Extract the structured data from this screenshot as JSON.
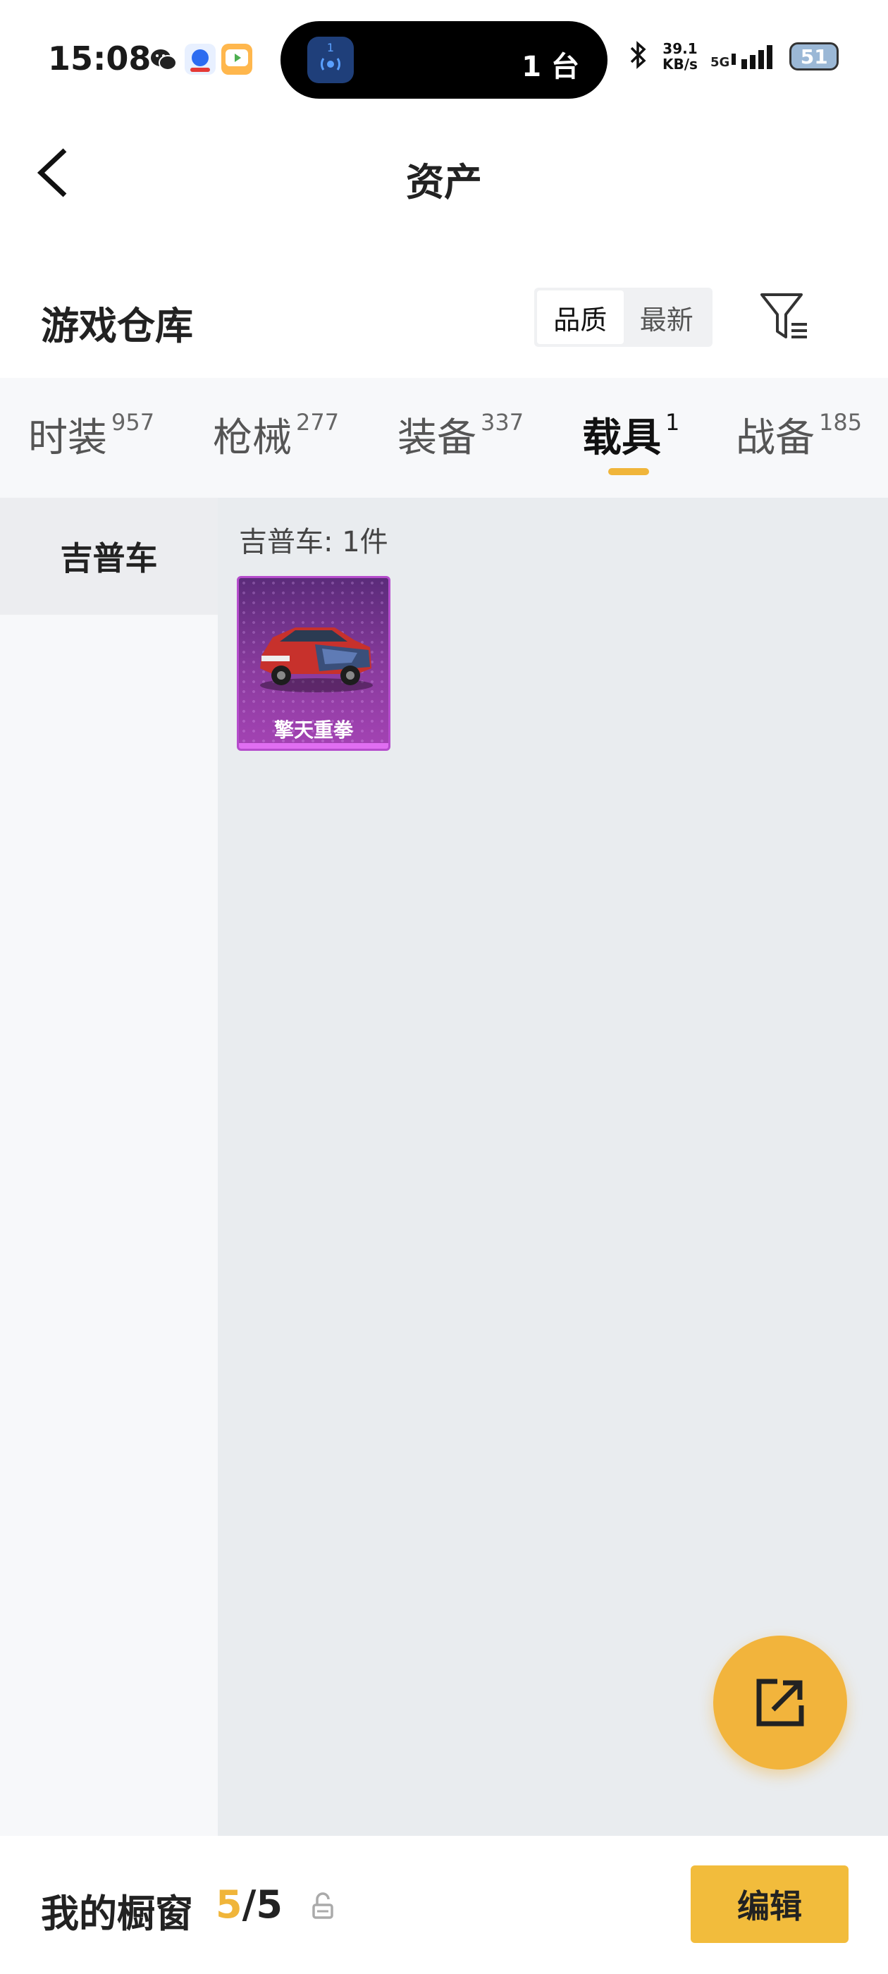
{
  "status": {
    "time": "15:08",
    "island_badge": "1",
    "island_text": "1 台",
    "net_speed_value": "39.1",
    "net_speed_unit": "KB/s",
    "network": "5G",
    "battery": "51"
  },
  "nav": {
    "title": "资产"
  },
  "warehouse": {
    "title": "游戏仓库",
    "sort_options": [
      "品质",
      "最新"
    ],
    "active_sort": "品质"
  },
  "tabs": [
    {
      "label": "时装",
      "count": "957"
    },
    {
      "label": "枪械",
      "count": "277"
    },
    {
      "label": "装备",
      "count": "337"
    },
    {
      "label": "载具",
      "count": "1"
    },
    {
      "label": "战备",
      "count": "185"
    }
  ],
  "active_tab": "载具",
  "sidebar": {
    "items": [
      {
        "label": "吉普车"
      }
    ]
  },
  "content": {
    "group_title": "吉普车: 1件",
    "items": [
      {
        "name": "擎天重拳",
        "rarity_color": "#a443b4"
      }
    ]
  },
  "bottom": {
    "showcase_label": "我的橱窗",
    "showcase_current": "5",
    "showcase_sep": "/",
    "showcase_total": "5",
    "edit_label": "编辑"
  },
  "colors": {
    "accent": "#f2bc3c",
    "rarity_purple": "#a443b4"
  }
}
